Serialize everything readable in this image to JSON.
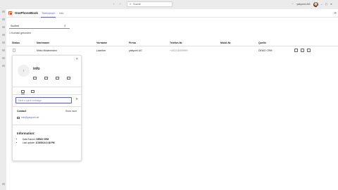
{
  "teams": {
    "search_placeholder": "Suche",
    "account_name": "yakyomi AG"
  },
  "app": {
    "name": "OnePhoneBook",
    "tabs": [
      {
        "label": "Telefonbuch",
        "active": true
      },
      {
        "label": "Info",
        "active": false
      }
    ]
  },
  "search": {
    "value": "Suchen"
  },
  "result_count": "1 Kontakt gefunden",
  "table": {
    "columns": [
      "Status",
      "Nachname",
      "Vorname",
      "Firma",
      "Telefon-Nr.",
      "Mobil-Nr.",
      "Quelle"
    ],
    "rows": [
      {
        "status": "",
        "nachname": "Mirko Mustermann",
        "vorname": "Lawcher",
        "firma": "yakyomi AG",
        "telefon": "+492216039999",
        "mobil": "",
        "quelle": "DEMO CRM"
      }
    ]
  },
  "card": {
    "avatar_initials": "I",
    "name": "info",
    "quick_message_placeholder": "Send a quick message",
    "contact_label": "Contact",
    "show_more": "Show more",
    "email": "info@yakyomi.de",
    "information_heading": "Information:",
    "info_items": [
      {
        "label": "Data Source:",
        "value": "DEMO CRM"
      },
      {
        "label": "Last update:",
        "value": "1/15/2024 2:48 PM"
      }
    ]
  },
  "colors": {
    "accent": "#5b5fc7",
    "app_logo": "#e35b2d",
    "presence": "#92c353"
  }
}
